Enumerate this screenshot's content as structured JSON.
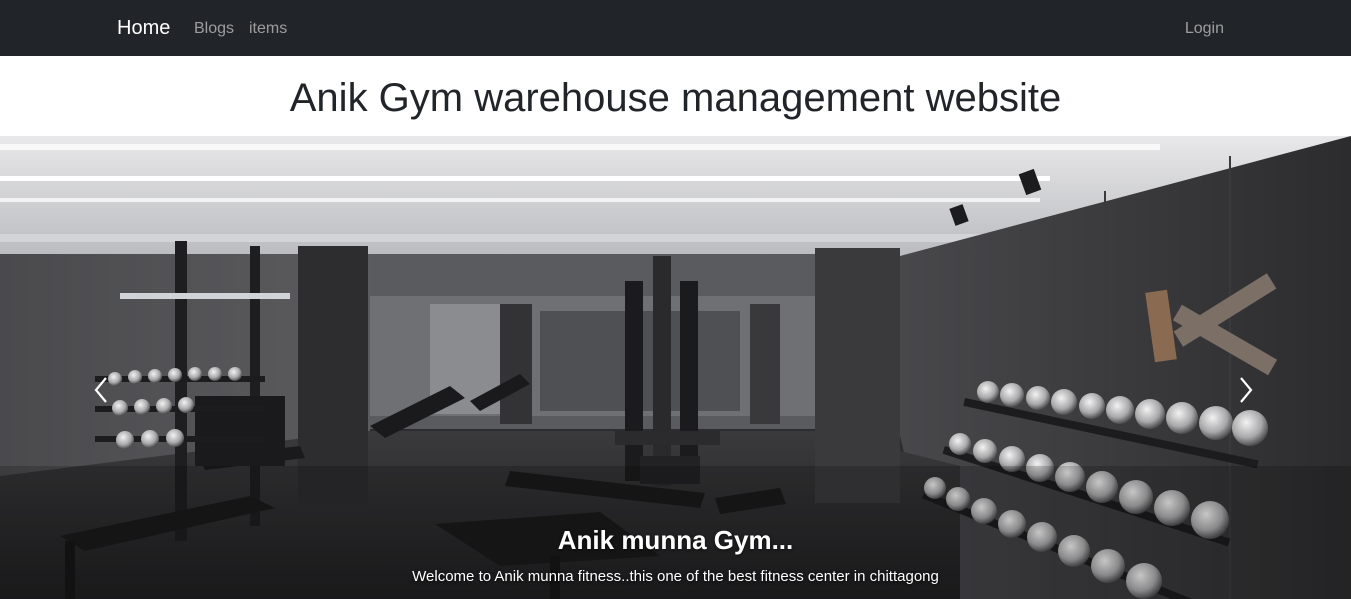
{
  "navbar": {
    "brand": "Home",
    "links": [
      "Blogs",
      "items"
    ],
    "login": "Login",
    "background": "#212529"
  },
  "page": {
    "title": "Anik Gym warehouse management website"
  },
  "carousel": {
    "image": "gym-interior-photo",
    "prev_icon": "chevron-left-icon",
    "next_icon": "chevron-right-icon",
    "caption_title": "Anik munna Gym...",
    "caption_text": "Welcome to Anik munna fitness..this one of the best fitness center in chittagong"
  }
}
